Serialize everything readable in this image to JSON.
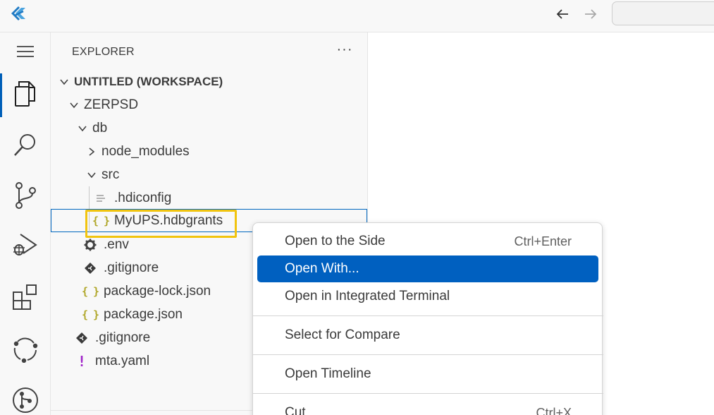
{
  "explorer": {
    "title": "EXPLORER",
    "more_actions": "···"
  },
  "tree": {
    "workspace": "UNTITLED (WORKSPACE)",
    "items": [
      {
        "label": "ZERPSD",
        "icon": "chevron-down-icon"
      },
      {
        "label": "db",
        "icon": "chevron-down-icon"
      },
      {
        "label": "node_modules",
        "icon": "chevron-right-icon"
      },
      {
        "label": "src",
        "icon": "chevron-down-icon"
      },
      {
        "label": ".hdiconfig",
        "icon": "file-lines-icon"
      },
      {
        "label": "MyUPS.hdbgrants",
        "icon": "json-braces-icon",
        "selected": true
      },
      {
        "label": ".env",
        "icon": "gear-icon"
      },
      {
        "label": ".gitignore",
        "icon": "git-diamond-icon"
      },
      {
        "label": "package-lock.json",
        "icon": "json-braces-icon"
      },
      {
        "label": "package.json",
        "icon": "json-braces-icon"
      },
      {
        "label": ".gitignore",
        "icon": "git-diamond-icon"
      },
      {
        "label": "mta.yaml",
        "icon": "yaml-exclamation-icon"
      }
    ]
  },
  "context_menu": {
    "items": [
      {
        "label": "Open to the Side",
        "shortcut": "Ctrl+Enter"
      },
      {
        "label": "Open With...",
        "shortcut": "",
        "focused": true
      },
      {
        "label": "Open in Integrated Terminal",
        "shortcut": ""
      },
      {
        "label": "Select for Compare",
        "shortcut": ""
      },
      {
        "label": "Open Timeline",
        "shortcut": ""
      },
      {
        "label": "Cut",
        "shortcut": "Ctrl+X"
      }
    ]
  },
  "colors": {
    "accent": "#005fb8",
    "menu_focus": "#0060c0",
    "highlight_box": "#f1c40f",
    "json_icon": "#b0a72a",
    "yaml_icon": "#a025c9"
  }
}
